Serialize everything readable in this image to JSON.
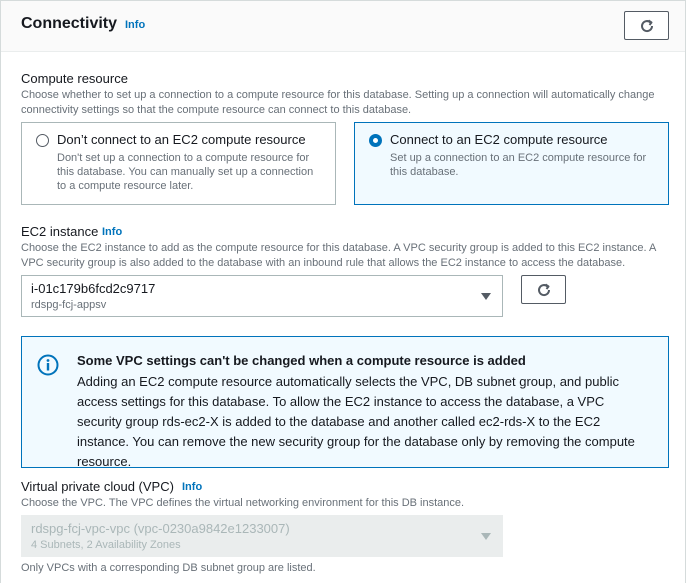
{
  "section": {
    "title": "Connectivity",
    "info_label": "Info"
  },
  "compute": {
    "label": "Compute resource",
    "description": "Choose whether to set up a connection to a compute resource for this database. Setting up a connection will automatically change connectivity settings so that the compute resource can connect to this database.",
    "options": [
      {
        "title": "Don’t connect to an EC2 compute resource",
        "description": "Don't set up a connection to a compute resource for this database. You can manually set up a connection to a compute resource later.",
        "selected": false
      },
      {
        "title": "Connect to an EC2 compute resource",
        "description": "Set up a connection to an EC2 compute resource for this database.",
        "selected": true
      }
    ]
  },
  "ec2": {
    "label": "EC2 instance",
    "info_label": "Info",
    "description": "Choose the EC2 instance to add as the compute resource for this database. A VPC security group is added to this EC2 instance. A VPC security group is also added to the database with an inbound rule that allows the EC2 instance to access the database.",
    "selected_id": "i-01c179b6fcd2c9717",
    "selected_name": "rdspg-fcj-appsv"
  },
  "alert": {
    "title": "Some VPC settings can't be changed when a compute resource is added",
    "body": "Adding an EC2 compute resource automatically selects the VPC, DB subnet group, and public access settings for this database. To allow the EC2 instance to access the database, a VPC security group rds-ec2-X is added to the database and another called ec2-rds-X to the EC2 instance. You can remove the new security group for the database only by removing the compute resource.",
    "icon": "info-circle-icon"
  },
  "vpc": {
    "label": "Virtual private cloud (VPC)",
    "info_label": "Info",
    "description": "Choose the VPC. The VPC defines the virtual networking environment for this DB instance.",
    "selected_value": "rdspg-fcj-vpc-vpc (vpc-0230a9842e1233007)",
    "selected_sub": "4 Subnets, 2 Availability Zones",
    "footer": "Only VPCs with a corresponding DB subnet group are listed."
  },
  "colors": {
    "accent": "#0073bb",
    "border": "#aab7b8",
    "disabled_bg": "#eaeded"
  }
}
